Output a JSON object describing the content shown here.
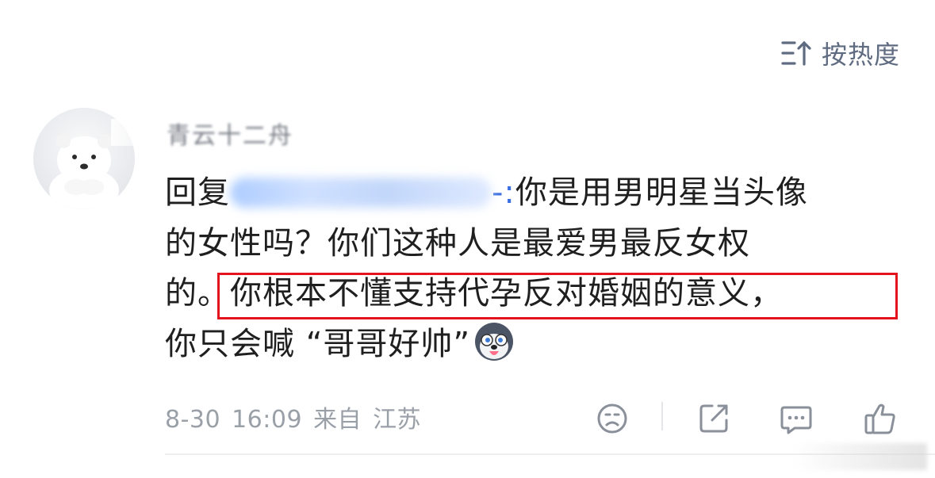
{
  "sort": {
    "label": "按热度"
  },
  "comment": {
    "username": "青云十二舟",
    "reply_prefix": "回复",
    "mention_tail": "-:",
    "line1_rest": "你是用男明星当头像",
    "line2": "的女性吗？你们这种人是最爱男最反女权",
    "line3_start": "的。",
    "line3_highlight": "你根本不懂支持代孕反对婚姻的意义，",
    "line4": "你只会喊 “哥哥好帅”"
  },
  "meta": {
    "date": "8-30",
    "time": "16:09",
    "location_prefix": "来自",
    "location": "江苏"
  },
  "icons": [
    "sort-icon",
    "avatar-polar-bear",
    "husky-emoji-icon",
    "dislike-icon",
    "share-icon",
    "reply-icon",
    "like-icon"
  ],
  "colors": {
    "accent_red": "#e3141e",
    "meta_gray": "#9aa0a8",
    "mention_blue": "#3c6fe0"
  }
}
